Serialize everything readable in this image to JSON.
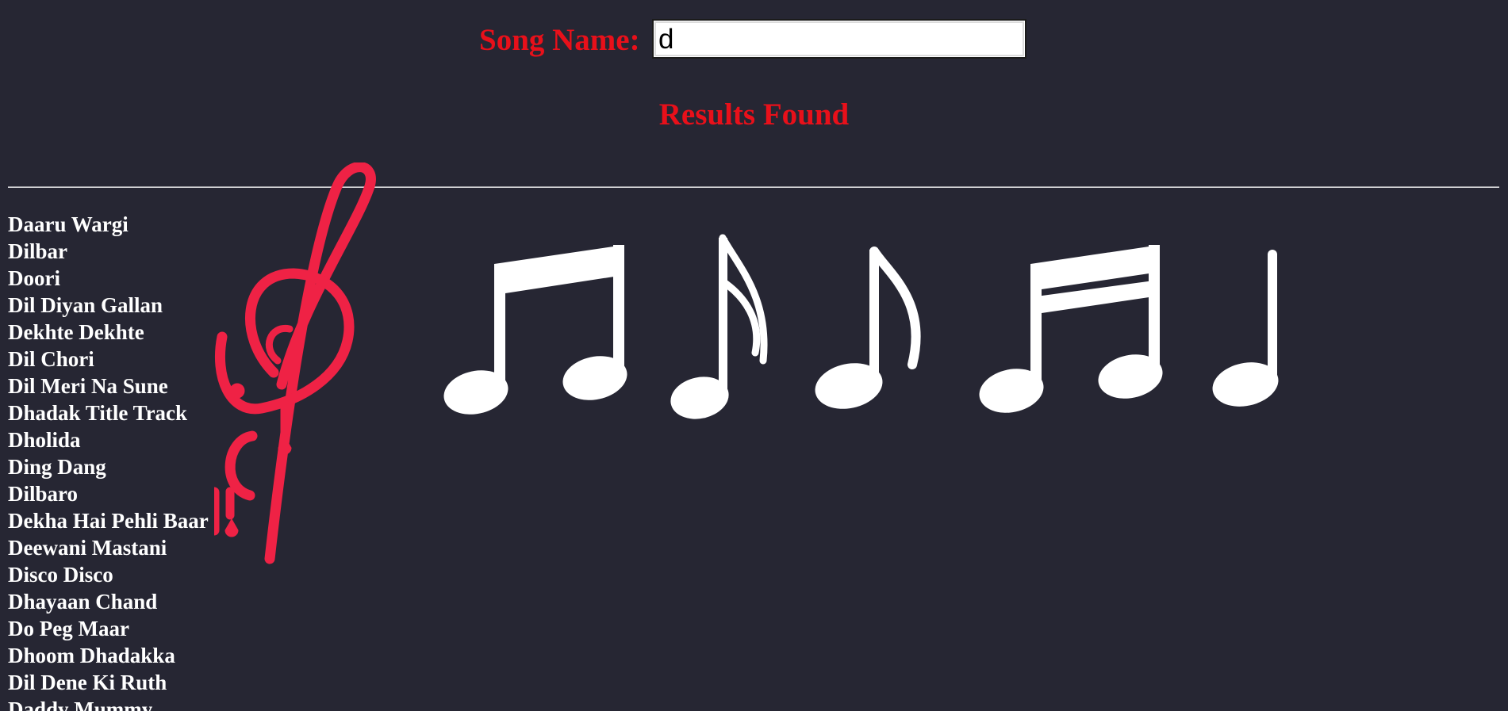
{
  "search": {
    "label": "Song Name:",
    "value": "d"
  },
  "results": {
    "title": "Results Found",
    "songs": [
      "Daaru Wargi",
      "Dilbar",
      "Doori",
      "Dil Diyan Gallan",
      "Dekhte Dekhte",
      "Dil Chori",
      "Dil Meri Na Sune",
      "Dhadak Title Track",
      "Dholida",
      "Ding Dang",
      "Dilbaro",
      "Dekha Hai Pehli Baar",
      "Deewani Mastani",
      "Disco Disco",
      "Dhayaan Chand",
      "Do Peg Maar",
      "Dhoom Dhadakka",
      "Dil Dene Ki Ruth",
      "Daddy Mummy"
    ]
  },
  "theme": {
    "background": "#262633",
    "accent": "#e8101a",
    "clef_color": "#ef2245",
    "text_color": "#ffffff"
  },
  "artwork": {
    "icons": [
      "treble-clef-icon",
      "beamed-eighth-notes-icon",
      "sixteenth-note-icon",
      "eighth-note-icon",
      "beamed-sixteenth-notes-icon",
      "quarter-note-icon"
    ]
  }
}
